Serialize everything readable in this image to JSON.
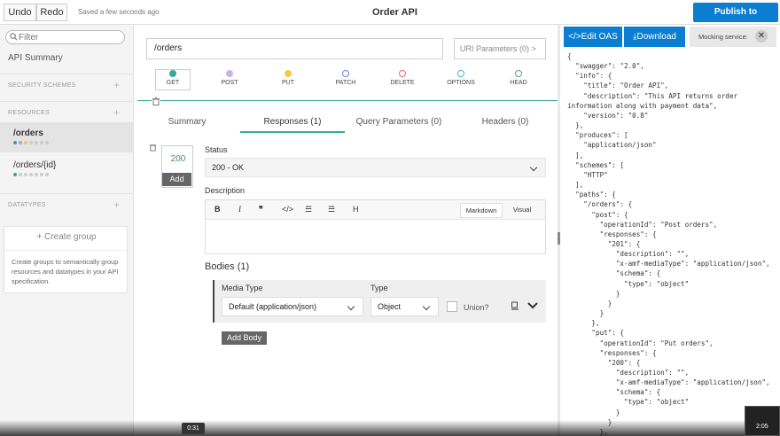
{
  "topbar": {
    "undo_label": "Undo",
    "redo_label": "Redo",
    "saved_status": "Saved a few seconds ago",
    "title": "Order API",
    "publish_label": "Publish to Exchange"
  },
  "sidebar": {
    "filter_placeholder": "Filter",
    "api_summary": "API Summary",
    "security_schemes": "SECURITY SCHEMES",
    "resources_header": "RESOURCES",
    "resources": [
      {
        "name": "/orders",
        "active": true
      },
      {
        "name": "/orders/{id}",
        "active": false
      }
    ],
    "datatypes_header": "DATATYPES",
    "create_group": "+ Create group",
    "group_description": "Create groups to semantically group resources and datatypes in your API specification."
  },
  "main": {
    "path": "/orders",
    "uri_parameters": "URI Parameters (0)",
    "methods": [
      {
        "label": "GET",
        "color": "#3aa6a0",
        "active": true
      },
      {
        "label": "POST",
        "color": "#c9b4e8",
        "active": false
      },
      {
        "label": "PUT",
        "color": "#f4c84a",
        "active": false
      },
      {
        "label": "PATCH",
        "color": "#ffffff",
        "active": false
      },
      {
        "label": "DELETE",
        "color": "#ffffff",
        "active": false
      },
      {
        "label": "OPTIONS",
        "color": "#ffffff",
        "active": false
      },
      {
        "label": "HEAD",
        "color": "#ffffff",
        "active": false
      }
    ],
    "tabs": [
      "Summary",
      "Responses (1)",
      "Query Parameters (0)",
      "Headers (0)"
    ],
    "response_code": "200",
    "add_label": "Add",
    "status_label": "Status",
    "status_value": "200 - OK",
    "description_label": "Description",
    "markdown_label": "Markdown",
    "visual_label": "Visual",
    "bodies_label": "Bodies (1)",
    "media_type_label": "Media Type",
    "media_type_value": "Default (application/json)",
    "type_label": "Type",
    "type_value": "Object",
    "union_label": "Union?",
    "add_body_label": "Add Body"
  },
  "right": {
    "edit_oas": "Edit OAS",
    "download": "Download",
    "mocking_service": "Mocking service:",
    "json_lines": [
      "{",
      "  \"swagger\": \"2.0\",",
      "  \"info\": {",
      "    \"title\": \"Order API\",",
      "    \"description\": \"This API returns order",
      "information along with payment data\",",
      "    \"version\": \"0.8\"",
      "  },",
      "  \"produces\": [",
      "    \"application/json\"",
      "  ],",
      "  \"schemes\": [",
      "    \"HTTP\"",
      "  ],",
      "  \"paths\": {",
      "    \"/orders\": {",
      "      \"post\": {",
      "        \"operationId\": \"Post orders\",",
      "        \"responses\": {",
      "          \"201\": {",
      "            \"description\": \"\",",
      "            \"x-amf-mediaType\": \"application/json\",",
      "            \"schema\": {",
      "              \"type\": \"object\"",
      "            }",
      "          }",
      "        }",
      "      },",
      "      \"put\": {",
      "        \"operationId\": \"Put orders\",",
      "        \"responses\": {",
      "          \"200\": {",
      "            \"description\": \"\",",
      "            \"x-amf-mediaType\": \"application/json\",",
      "            \"schema\": {",
      "              \"type\": \"object\"",
      "            }",
      "          }",
      "        },"
    ]
  },
  "video": {
    "current_time": "0:31",
    "duration": "2:05"
  },
  "colors": {
    "accent": "#0b7ed1",
    "teal": "#3aa6a0"
  }
}
